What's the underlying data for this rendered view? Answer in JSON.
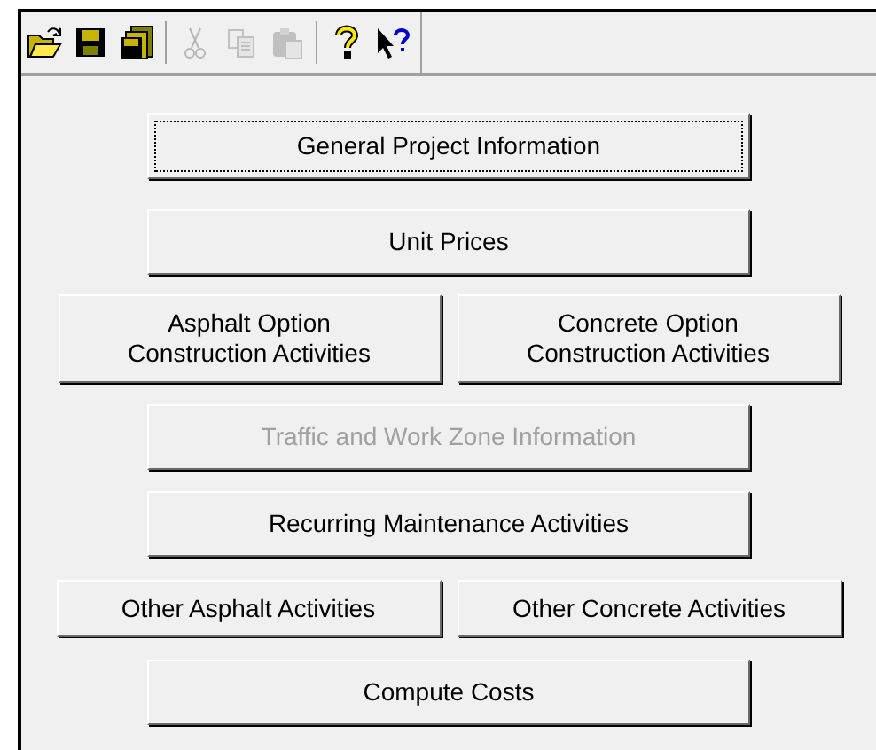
{
  "toolbar": [
    {
      "kind": "open",
      "disabled": false
    },
    {
      "kind": "save",
      "disabled": false
    },
    {
      "kind": "save-all",
      "disabled": false
    },
    {
      "kind": "separator"
    },
    {
      "kind": "cut",
      "disabled": true
    },
    {
      "kind": "copy",
      "disabled": true
    },
    {
      "kind": "paste",
      "disabled": true
    },
    {
      "kind": "separator"
    },
    {
      "kind": "help",
      "disabled": false
    },
    {
      "kind": "context-help",
      "disabled": false
    }
  ],
  "button_rows": [
    {
      "buttons": [
        {
          "label": "General Project Information",
          "disabled": false,
          "focused": true
        }
      ]
    },
    {
      "buttons": [
        {
          "label": "Unit Prices",
          "disabled": false,
          "focused": false
        }
      ]
    },
    {
      "buttons": [
        {
          "label": "Asphalt  Option\nConstruction Activities",
          "disabled": false,
          "focused": false
        },
        {
          "label": "Concrete  Option\nConstruction Activities",
          "disabled": false,
          "focused": false
        }
      ]
    },
    {
      "buttons": [
        {
          "label": "Traffic and Work Zone Information",
          "disabled": true,
          "focused": false
        }
      ]
    },
    {
      "buttons": [
        {
          "label": "Recurring Maintenance Activities",
          "disabled": false,
          "focused": false
        }
      ]
    },
    {
      "buttons": [
        {
          "label": "Other Asphalt Activities",
          "disabled": false,
          "focused": false
        },
        {
          "label": "Other Concrete Activities",
          "disabled": false,
          "focused": false
        }
      ]
    },
    {
      "buttons": [
        {
          "label": "Compute Costs",
          "disabled": false,
          "focused": false
        }
      ]
    }
  ]
}
